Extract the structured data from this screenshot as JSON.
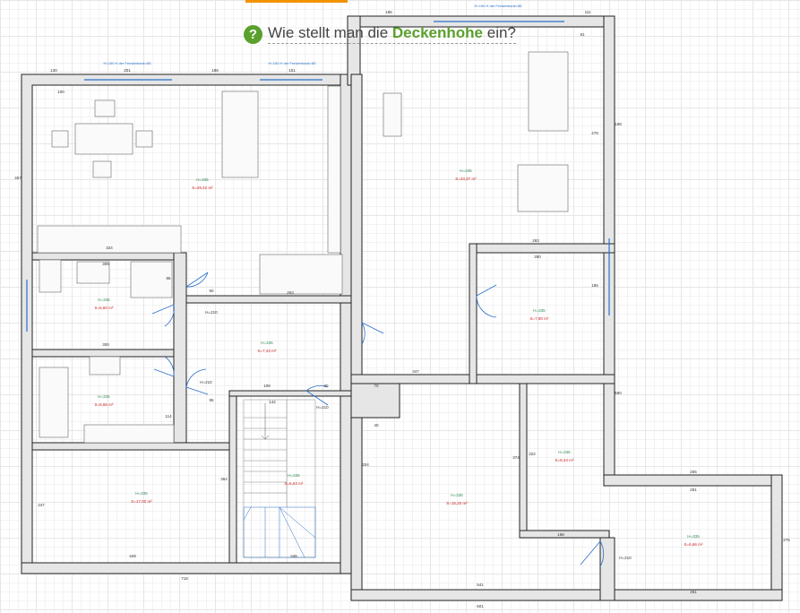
{
  "help": {
    "icon": "question-mark-icon",
    "text_before": "Wie stellt man die",
    "text_strong": "Deckenhohe",
    "text_after": "ein?"
  },
  "colors": {
    "accent": "#5aa02c",
    "orange": "#f39200",
    "wall": "#e6e6e6",
    "dimension_blue": "#2a6fc9",
    "area_red": "#cc2222",
    "height_green": "#2e8b57"
  },
  "rooms": [
    {
      "id": "living",
      "height": "H=335",
      "area": "S=29,42 m²"
    },
    {
      "id": "gym",
      "height": "H=335",
      "area": "S=33,37 m²"
    },
    {
      "id": "bath1",
      "height": "H=335",
      "area": "S=6,60 m²"
    },
    {
      "id": "hall",
      "height": "H=335",
      "area": "S=7,43 m²"
    },
    {
      "id": "room",
      "height": "H=335",
      "area": "S=7,90 m²"
    },
    {
      "id": "bath2",
      "height": "H=335",
      "area": "S=5,65 m²"
    },
    {
      "id": "stairs",
      "height": "H=335",
      "area": "S=6,63 m²"
    },
    {
      "id": "storage",
      "height": "H=335",
      "area": "S=8,44 m²"
    },
    {
      "id": "bedroom",
      "height": "H=335",
      "area": "S=17,00 m²"
    },
    {
      "id": "big",
      "height": "H=335",
      "area": "S=16,25 m²"
    },
    {
      "id": "annex",
      "height": "H=335",
      "area": "S=6,66 m²"
    }
  ],
  "dims": {
    "d130": "130",
    "d201": "201",
    "d188": "188",
    "d151": "151",
    "d186": "186",
    "d111": "111",
    "d100": "100",
    "d81": "81",
    "d478": "478",
    "d283": "283",
    "d280": "280",
    "d185": "185",
    "d347": "347",
    "d324": "324",
    "d305": "305",
    "d300": "300",
    "d263": "263",
    "d429": "429",
    "d142": "142",
    "d245": "245",
    "d281": "281",
    "d265": "265",
    "d251": "251",
    "d541": "541",
    "d718": "718",
    "d601": "601",
    "d1038": "1038",
    "d467": "467",
    "d480": "480",
    "d530": "530",
    "d345": "345",
    "d247": "247",
    "d276": "276",
    "d374": "374",
    "d364": "364",
    "d322": "322",
    "d204": "204",
    "d151b": "151",
    "d114": "114",
    "d86": "86",
    "d12": "12",
    "d20": "20",
    "d90": "90",
    "d95": "95",
    "d80": "80",
    "d60": "60",
    "d108": "108",
    "d166": "166",
    "d116": "116",
    "d74": "74",
    "d71": "71",
    "d70": "70",
    "d40": "40",
    "d43": "43",
    "d590": "590",
    "d176": "176",
    "d281b": "281",
    "d198": "198",
    "d168": "168",
    "h210a": "H=210",
    "h210b": "H=210",
    "h210c": "H=210",
    "h210d": "H=210",
    "h210e": "H=210",
    "h210f": "H=210",
    "h113a": "H=113",
    "h113b": "H=113",
    "h210g": "H=210"
  },
  "windows": {
    "w1": "H=150 H der Fensterbank=85",
    "w2": "H=150 H der Fensterbank=85",
    "w3": "H=150 H der Fensterbank=85",
    "w4": "H=150 H der Fensterbank=85",
    "w5": "H=150 H der Fensterbank=85"
  }
}
